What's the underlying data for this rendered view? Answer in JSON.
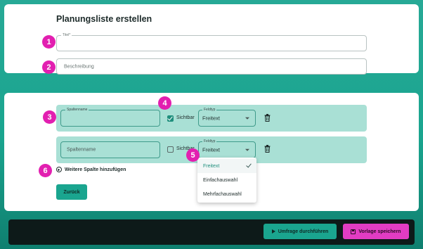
{
  "page": {
    "title": "Planungsliste erstellen"
  },
  "basic_fields": {
    "title_field": {
      "label": "Titel*",
      "value": ""
    },
    "description_field": {
      "placeholder": "Beschreibung",
      "value": ""
    }
  },
  "columns": [
    {
      "name_label": "Spaltenname",
      "name_value": "",
      "visible_label": "Sichtbar",
      "visible_checked": true,
      "type_label": "Feldtyp",
      "type_value": "Freitext"
    },
    {
      "name_placeholder": "Spaltenname",
      "name_value": "",
      "visible_label": "Sichtbar",
      "visible_checked": false,
      "type_label": "Feldtyp",
      "type_value": "Freitext"
    }
  ],
  "dropdown": {
    "options": [
      "Freitext",
      "Einfachauswahl",
      "Mehrfachauswahl"
    ],
    "selected": "Freitext"
  },
  "annotations": [
    "1",
    "2",
    "3",
    "4",
    "5",
    "6"
  ],
  "actions": {
    "add_column_label": "Weitere Spalte hinzufügen",
    "back_label": "Zurück",
    "run_survey_label": "Umfrage durchführen",
    "save_template_label": "Vorlage speichern"
  },
  "icons": {
    "delete": "trash-icon",
    "add": "plus-circle-icon",
    "run": "play-icon",
    "save": "save-icon",
    "select_arrow": "chevron-down-icon",
    "check": "check-icon"
  },
  "colors": {
    "teal_accent": "#1aa58f",
    "row_background": "#a9e0d5",
    "badge_magenta": "#e21fb0",
    "save_button": "#e23cc3",
    "bottom_bar": "#0d1a19"
  }
}
